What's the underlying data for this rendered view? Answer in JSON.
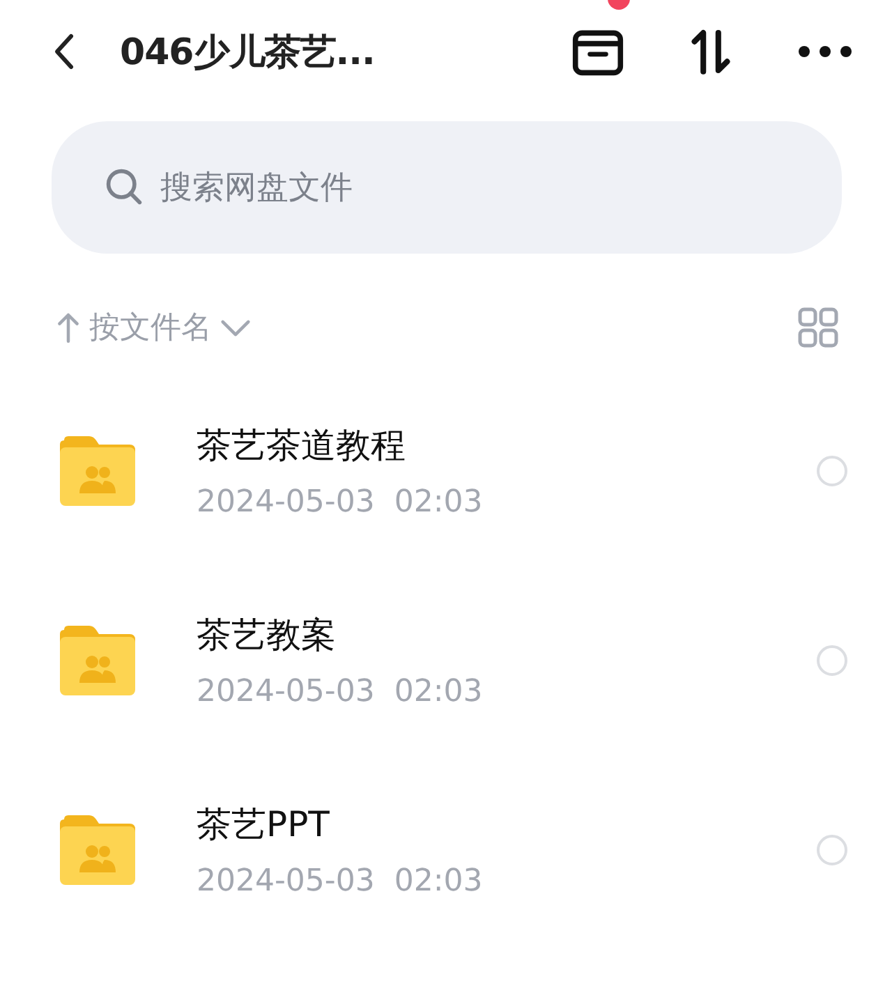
{
  "header": {
    "title": "046少儿茶艺...",
    "notification_dot": true
  },
  "search": {
    "placeholder": "搜索网盘文件"
  },
  "sort": {
    "label": "按文件名"
  },
  "files": [
    {
      "name": "茶艺茶道教程",
      "date": "2024-05-03  02:03",
      "selected": false
    },
    {
      "name": "茶艺教案",
      "date": "2024-05-03  02:03",
      "selected": false
    },
    {
      "name": "茶艺PPT",
      "date": "2024-05-03  02:03",
      "selected": false
    }
  ]
}
